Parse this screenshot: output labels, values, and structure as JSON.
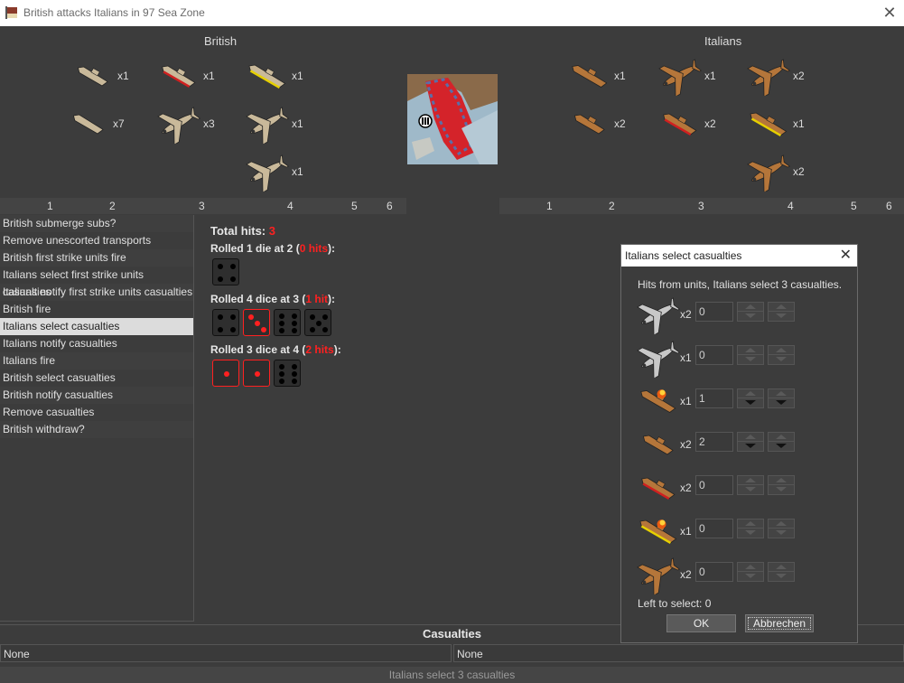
{
  "window": {
    "title": "British attacks Italians in 97 Sea Zone",
    "icon": "app-flag-icon",
    "close_icon": "close-icon"
  },
  "british": {
    "label": "British",
    "units": [
      {
        "icon": "destroyer-icon",
        "count": "x1"
      },
      {
        "icon": "cruiser-icon",
        "count": "x1"
      },
      {
        "icon": "battleship-icon",
        "count": "x1"
      },
      {
        "icon": "submarine-icon",
        "count": "x7"
      },
      {
        "icon": "fighter-icon",
        "count": "x3"
      },
      {
        "icon": "bomber-icon",
        "count": "x1"
      },
      {
        "icon": "tactical-bomber-icon",
        "count": "x1"
      }
    ],
    "numbers": [
      "1",
      "2",
      "3",
      "4",
      "5",
      "6"
    ]
  },
  "italians": {
    "label": "Italians",
    "units": [
      {
        "icon": "carrier-icon",
        "count": "x1"
      },
      {
        "icon": "bomber-icon",
        "count": "x1"
      },
      {
        "icon": "fighter-icon",
        "count": "x2"
      },
      {
        "icon": "destroyer-icon",
        "count": "x2"
      },
      {
        "icon": "cruiser-icon",
        "count": "x2"
      },
      {
        "icon": "battleship-icon",
        "count": "x1"
      },
      {
        "icon": "tactical-bomber-icon",
        "count": "x2"
      }
    ],
    "numbers": [
      "1",
      "2",
      "3",
      "4",
      "5",
      "6"
    ]
  },
  "steps": {
    "items": [
      "British submerge subs?",
      "Remove unescorted transports",
      "British first strike units fire",
      "Italians select first strike units casualties",
      "Italians notify first strike units casualties",
      "British fire",
      "Italians select casualties",
      "Italians notify casualties",
      "Italians fire",
      "British select casualties",
      "British notify casualties",
      "Remove casualties",
      "British withdraw?"
    ],
    "selected_index": 6
  },
  "dice": {
    "total_label": "Total hits:",
    "total_value": "3",
    "rolls": [
      {
        "prefix": "Rolled 1 die at 2 (",
        "hits": "0 hits",
        "suffix": "):",
        "values": [
          4
        ],
        "hit_flags": [
          false
        ]
      },
      {
        "prefix": "Rolled 4 dice at 3 (",
        "hits": "1 hit",
        "suffix": "):",
        "values": [
          4,
          3,
          6,
          5
        ],
        "hit_flags": [
          false,
          true,
          false,
          false
        ]
      },
      {
        "prefix": "Rolled 3 dice at 4 (",
        "hits": "2 hits",
        "suffix": "):",
        "values": [
          1,
          1,
          6
        ],
        "hit_flags": [
          true,
          true,
          false
        ]
      }
    ]
  },
  "dialog": {
    "title": "Italians select casualties",
    "instruction": "Hits from units,  Italians select 3 casualties.",
    "rows": [
      {
        "icon": "fighter-icon",
        "count": "x2",
        "value": "0"
      },
      {
        "icon": "bomber-icon",
        "count": "x1",
        "value": "0"
      },
      {
        "icon": "damaged-carrier-icon",
        "count": "x1",
        "value": "1"
      },
      {
        "icon": "destroyer-icon",
        "count": "x2",
        "value": "2"
      },
      {
        "icon": "cruiser-icon",
        "count": "x2",
        "value": "0"
      },
      {
        "icon": "damaged-battleship-icon",
        "count": "x1",
        "value": "0"
      },
      {
        "icon": "tactical-bomber-icon",
        "count": "x2",
        "value": "0"
      }
    ],
    "left_to_select": "Left to select: 0",
    "ok_label": "OK",
    "cancel_label": "Abbrechen"
  },
  "casualties": {
    "title": "Casualties",
    "left": "None",
    "right": "None"
  },
  "status": "Italians select 3 casualties",
  "colors": {
    "hit_red": "#ff2020",
    "british_unit": "#c9b99a",
    "italian_unit": "#b5763a"
  }
}
